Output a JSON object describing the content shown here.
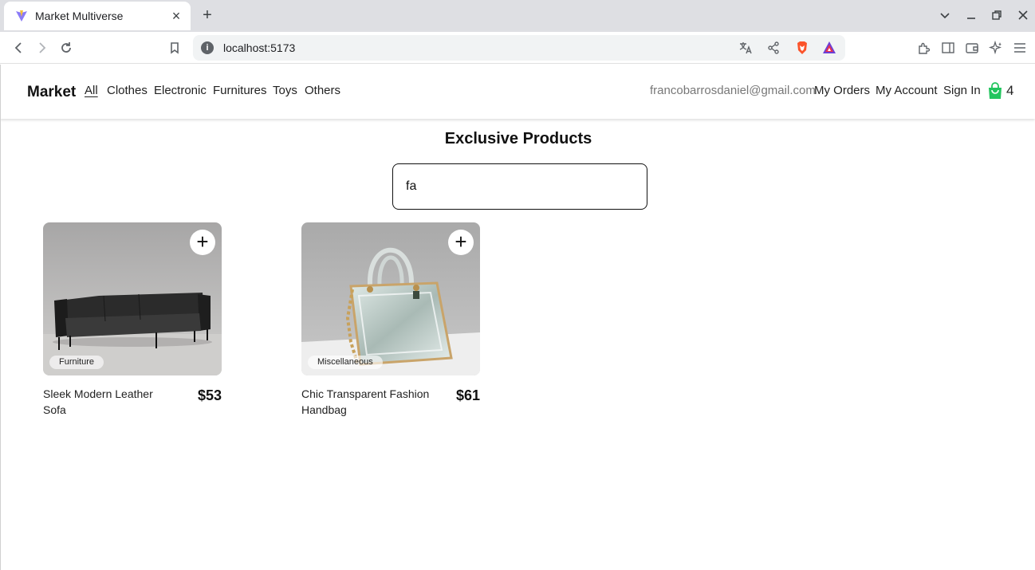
{
  "browser": {
    "tab_title": "Market Multiverse",
    "new_tab_symbol": "+",
    "tab_close_symbol": "×",
    "url": "localhost:5173"
  },
  "nav": {
    "brand": "Market",
    "categories": [
      "All",
      "Clothes",
      "Electronic",
      "Furnitures",
      "Toys",
      "Others"
    ],
    "active_category": "All",
    "email": "francobarrosdaniel@gmail.com",
    "my_orders": "My Orders",
    "my_account": "My Account",
    "sign_in": "Sign In",
    "cart_count": "4",
    "cart_color": "#22c55e"
  },
  "main": {
    "heading": "Exclusive Products",
    "search_value": "fa"
  },
  "products": [
    {
      "name": "Sleek Modern Leather Sofa",
      "price": "$53",
      "category": "Furniture",
      "add_symbol": "+"
    },
    {
      "name": "Chic Transparent Fashion Handbag",
      "price": "$61",
      "category": "Miscellaneous",
      "add_symbol": "+"
    }
  ]
}
